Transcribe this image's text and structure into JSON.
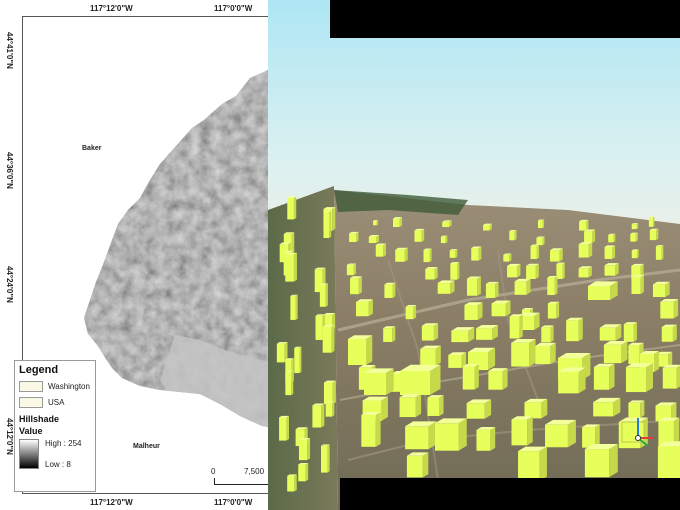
{
  "map": {
    "coords_top": [
      "117°12'0\"W",
      "117°0'0\"W"
    ],
    "coords_bottom": [
      "117°12'0\"W",
      "117°0'0\"W"
    ],
    "coords_left": [
      "44°41'0\"N",
      "44°36'0\"N",
      "44°24'0\"N",
      "44°12'0\"N"
    ],
    "places": {
      "baker": "Baker",
      "malheur": "Malheur"
    },
    "scale": {
      "zero": "0",
      "value": "7,500"
    }
  },
  "legend": {
    "title": "Legend",
    "items": [
      {
        "label": "Washington"
      },
      {
        "label": "USA"
      }
    ],
    "hillshade_title": "Hillshade",
    "value_title": "Value",
    "high": "High : 254",
    "low": "Low : 8"
  },
  "scene": {
    "building_color": "#e7ff5a"
  }
}
